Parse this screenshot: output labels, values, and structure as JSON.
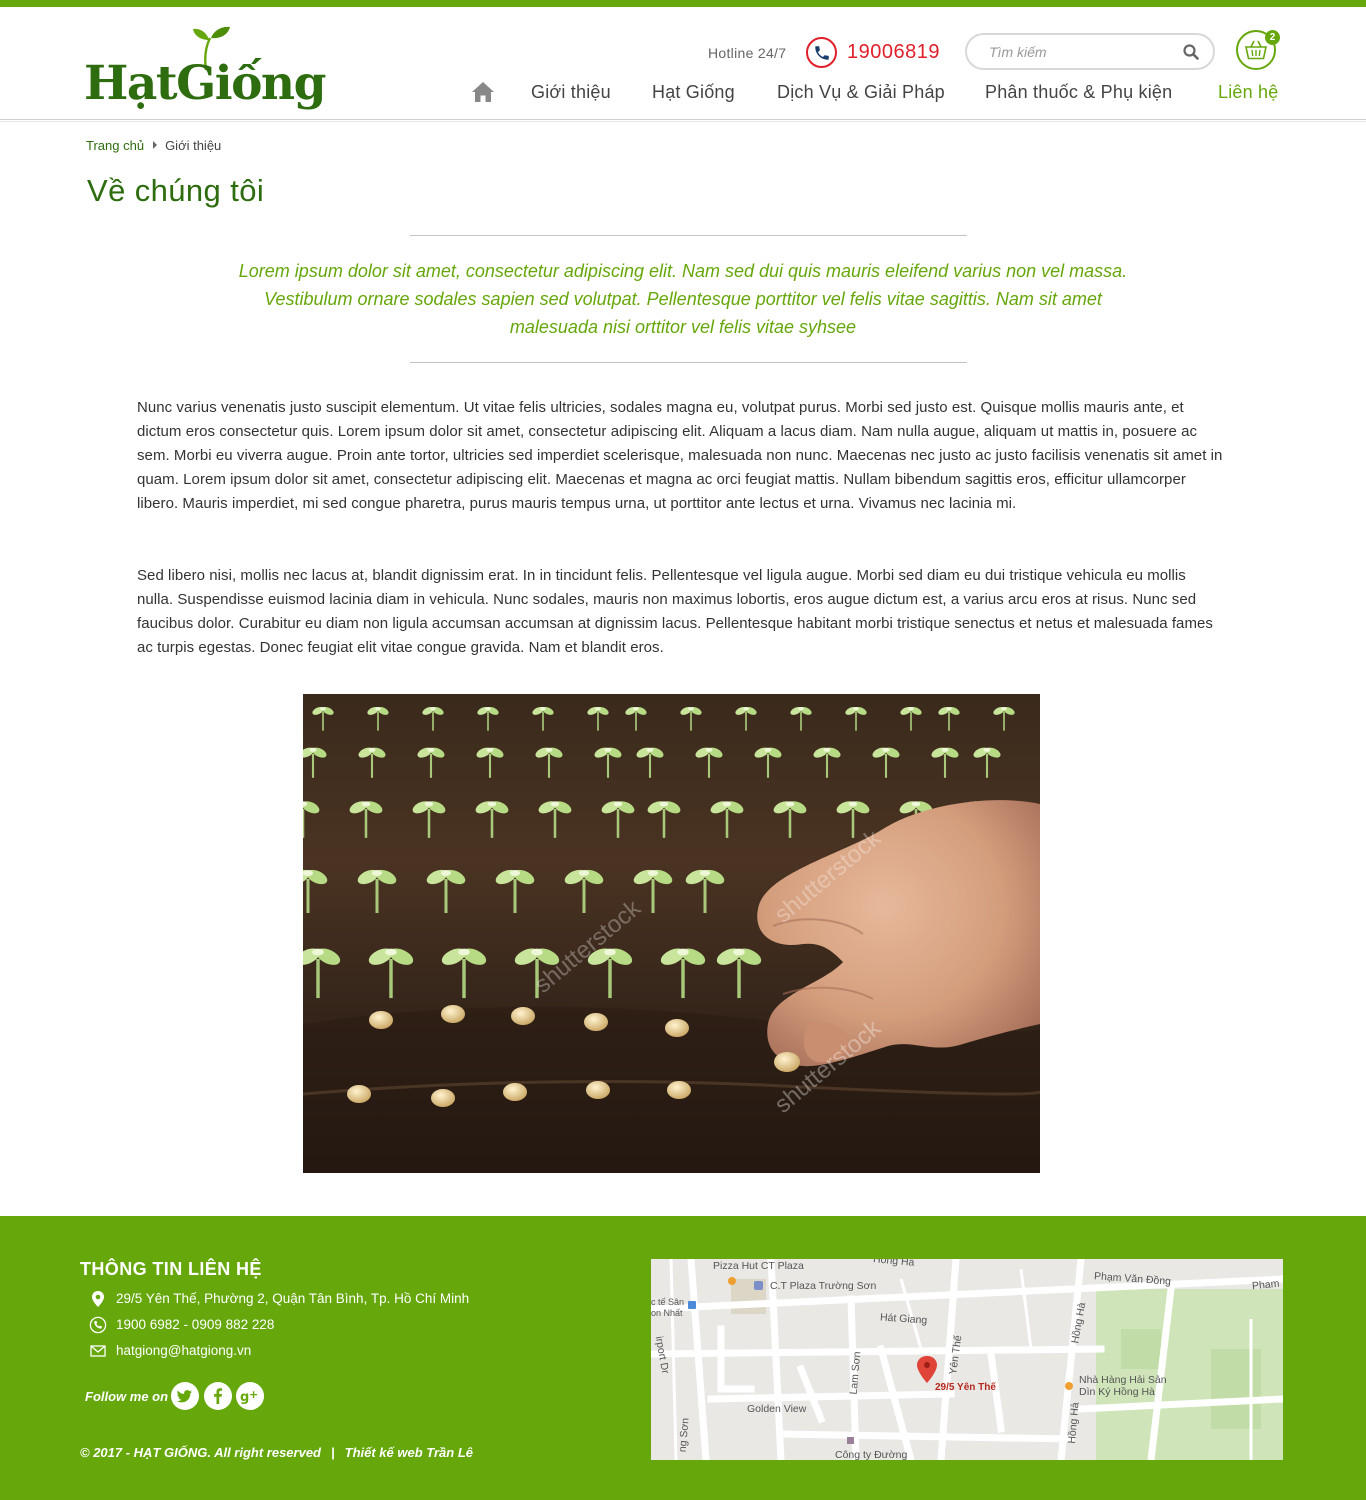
{
  "brand": {
    "logo_text": "HạtGiống",
    "accent": "#66a70b",
    "logo_color": "#2e6d0f",
    "hotline_color": "#e0202a"
  },
  "header": {
    "hotline_label": "Hotline 24/7",
    "hotline_number": "19006819",
    "search_placeholder": "Tìm kiếm",
    "cart_count": "2"
  },
  "nav": {
    "home_icon": "home-icon",
    "items": [
      {
        "label": "Giới thiệu"
      },
      {
        "label": "Hạt Giống"
      },
      {
        "label": "Dịch Vụ & Giải Pháp"
      },
      {
        "label": "Phân thuốc & Phụ kiện"
      },
      {
        "label": "Liên hệ"
      }
    ]
  },
  "breadcrumb": {
    "home": "Trang chủ",
    "current": "Giới thiệu"
  },
  "main": {
    "title": "Về chúng tôi",
    "quote": "Lorem ipsum dolor sit amet, consectetur adipiscing elit. Nam sed dui quis mauris eleifend varius non vel massa. Vestibulum ornare sodales sapien sed volutpat. Pellentesque porttitor vel felis vitae sagittis. Nam sit amet malesuada nisi orttitor vel felis vitae syhsee",
    "paragraphs": [
      "Nunc varius venenatis justo suscipit elementum. Ut vitae felis ultricies, sodales magna eu, volutpat purus. Morbi sed justo est. Quisque mollis mauris ante, et dictum eros consectetur quis. Lorem ipsum dolor sit amet, consectetur adipiscing elit. Aliquam a lacus diam. Nam nulla augue, aliquam ut mattis in, posuere ac sem. Morbi eu viverra augue. Proin ante tortor, ultricies sed imperdiet scelerisque, malesuada non nunc. Maecenas nec justo ac justo facilisis venenatis sit amet in quam. Lorem ipsum dolor sit amet, consectetur adipiscing elit. Maecenas et magna ac orci feugiat mattis. Nullam bibendum sagittis eros, efficitur ullamcorper libero. Mauris imperdiet, mi sed congue pharetra, purus mauris tempus urna, ut porttitor ante lectus et urna. Vivamus nec lacinia mi.",
      "Sed libero nisi, mollis nec lacus at, blandit dignissim erat. In in tincidunt felis. Pellentesque vel ligula augue. Morbi sed diam eu dui tristique vehicula eu mollis nulla. Suspendisse euismod lacinia diam in vehicula. Nunc sodales, mauris non maximus lobortis, eros augue dictum est, a varius arcu eros at risus. Nunc sed faucibus dolor. Curabitur eu diam non ligula accumsan accumsan at dignissim lacus. Pellentesque habitant morbi tristique senectus et netus et malesuada fames ac turpis egestas. Donec feugiat elit vitae congue gravida. Nam et blandit eros."
    ],
    "photo_watermark": "shutterstock"
  },
  "footer": {
    "heading": "THÔNG TIN LIÊN HỆ",
    "address": "29/5 Yên Thế, Phường 2, Quận Tân Bình, Tp. Hồ Chí Minh",
    "phones": "1900 6982 - 0909 882 228",
    "email": "hatgiong@hatgiong.vn",
    "follow_label": "Follow me on",
    "social": [
      "twitter-icon",
      "facebook-icon",
      "google-plus-icon"
    ],
    "copyright": "© 2017 - HẠT GIỐNG. All right reserved",
    "pipe": "|",
    "designer": "Thiết kế web Trần Lê"
  },
  "map": {
    "labels": {
      "pizza": "Pizza Hut CT Plaza",
      "ctplaza": "C.T Plaza Trường Sơn",
      "hongha_top": "Hồng Hà",
      "phamvandong": "Phạm Văn Đồng",
      "pham": "Pham",
      "te_san": "c tế Sân",
      "on_nhat": "on Nhất",
      "airport": "irport Dr",
      "hatgiang": "Hát Giang",
      "hongha_mid": "Hồng Hà",
      "yenthe_street": "Yên Thế",
      "lamson": "Lam Sơn",
      "pin": "29/5 Yên Thế",
      "nhahang1": "Nhà Hàng Hải Sản",
      "nhahang2": "Dìn Ký Hồng Hà",
      "golden": "Golden View",
      "hongha_bottom": "Hồng Hà",
      "son": "ng Sơn",
      "congty": "Công ty Đường"
    }
  }
}
